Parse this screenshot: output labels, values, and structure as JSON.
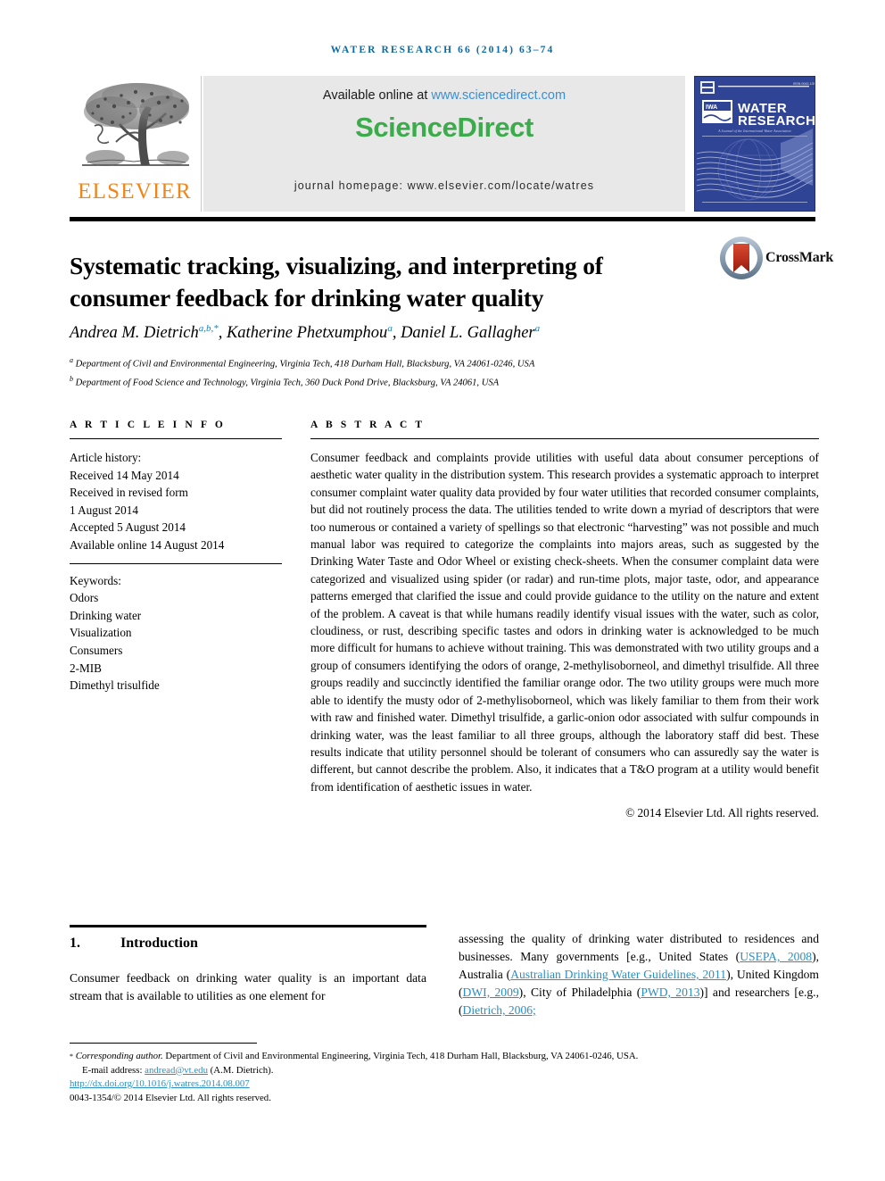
{
  "running_head": "water research 66 (2014) 63–74",
  "header": {
    "available_prefix": "Available online at ",
    "available_link": "www.sciencedirect.com",
    "sciencedirect_logo": "ScienceDirect",
    "journal_homepage": "journal homepage: www.elsevier.com/locate/watres",
    "publisher_name": "ELSEVIER",
    "cover": {
      "line1": "WATER",
      "line2": "RESEARCH",
      "iwa_badge": "IWA",
      "tagline": "A Journal of the International Water Association",
      "volume_label": "ISSN 0043-1354"
    }
  },
  "article": {
    "title": "Systematic tracking, visualizing, and interpreting of consumer feedback for drinking water quality",
    "crossmark_label": "CrossMark",
    "authors": [
      {
        "name": "Andrea M. Dietrich",
        "marks": "a,b,*"
      },
      {
        "name": "Katherine Phetxumphou",
        "marks": "a"
      },
      {
        "name": "Daniel L. Gallagher",
        "marks": "a"
      }
    ],
    "affiliations": [
      {
        "mark": "a",
        "text": "Department of Civil and Environmental Engineering, Virginia Tech, 418 Durham Hall, Blacksburg, VA 24061-0246, USA"
      },
      {
        "mark": "b",
        "text": "Department of Food Science and Technology, Virginia Tech, 360 Duck Pond Drive, Blacksburg, VA 24061, USA"
      }
    ]
  },
  "article_info": {
    "heading": "A R T I C L E   I N F O",
    "history_label": "Article history:",
    "history": [
      "Received 14 May 2014",
      "Received in revised form",
      "1 August 2014",
      "Accepted 5 August 2014",
      "Available online 14 August 2014"
    ],
    "keywords_label": "Keywords:",
    "keywords": [
      "Odors",
      "Drinking water",
      "Visualization",
      "Consumers",
      "2-MIB",
      "Dimethyl trisulfide"
    ]
  },
  "abstract": {
    "heading": "A B S T R A C T",
    "body": "Consumer feedback and complaints provide utilities with useful data about consumer perceptions of aesthetic water quality in the distribution system. This research provides a systematic approach to interpret consumer complaint water quality data provided by four water utilities that recorded consumer complaints, but did not routinely process the data. The utilities tended to write down a myriad of descriptors that were too numerous or contained a variety of spellings so that electronic “harvesting” was not possible and much manual labor was required to categorize the complaints into majors areas, such as suggested by the Drinking Water Taste and Odor Wheel or existing check-sheets. When the consumer complaint data were categorized and visualized using spider (or radar) and run-time plots, major taste, odor, and appearance patterns emerged that clarified the issue and could provide guidance to the utility on the nature and extent of the problem. A caveat is that while humans readily identify visual issues with the water, such as color, cloudiness, or rust, describing specific tastes and odors in drinking water is acknowledged to be much more difficult for humans to achieve without training. This was demonstrated with two utility groups and a group of consumers identifying the odors of orange, 2-methylisoborneol, and dimethyl trisulfide. All three groups readily and succinctly identified the familiar orange odor. The two utility groups were much more able to identify the musty odor of 2-methylisoborneol, which was likely familiar to them from their work with raw and finished water. Dimethyl trisulfide, a garlic-onion odor associated with sulfur compounds in drinking water, was the least familiar to all three groups, although the laboratory staff did best. These results indicate that utility personnel should be tolerant of consumers who can assuredly say the water is different, but cannot describe the problem. Also, it indicates that a T&O program at a utility would benefit from identification of aesthetic issues in water.",
    "copyright": "© 2014 Elsevier Ltd. All rights reserved."
  },
  "introduction": {
    "number": "1.",
    "title": "Introduction",
    "left_column": "Consumer feedback on drinking water quality is an important data stream that is available to utilities as one element for",
    "right_column": {
      "part1": "assessing the quality of drinking water distributed to residences and businesses. Many governments [e.g., United States (",
      "cite1": "USEPA, 2008",
      "part2": "), Australia (",
      "cite2": "Australian Drinking Water Guidelines, 2011",
      "part3": "), United Kingdom (",
      "cite3": "DWI, 2009",
      "part4": "), City of Philadelphia (",
      "cite4": "PWD, 2013",
      "part5": ")] and researchers [e.g., (",
      "cite5": "Dietrich, 2006;",
      "part6": ""
    }
  },
  "footnote": {
    "corresponding_marker": "*",
    "corresponding_label": "Corresponding author.",
    "corresponding_text": " Department of Civil and Environmental Engineering, Virginia Tech, 418 Durham Hall, Blacksburg, VA 24061-0246, USA.",
    "email_label": "E-mail address:",
    "email": "andread@vt.edu",
    "email_suffix": "(A.M. Dietrich).",
    "doi": "http://dx.doi.org/10.1016/j.watres.2014.08.007",
    "issn_line": "0043-1354/© 2014 Elsevier Ltd. All rights reserved."
  },
  "colors": {
    "journal_blue": "#0b6aa2",
    "link_blue": "#2b8fc4",
    "sciencedirect_green": "#3cab4b",
    "elsevier_orange": "#f08518",
    "cover_blue": "#2f4494",
    "crossmark_red": "#c0392b"
  }
}
